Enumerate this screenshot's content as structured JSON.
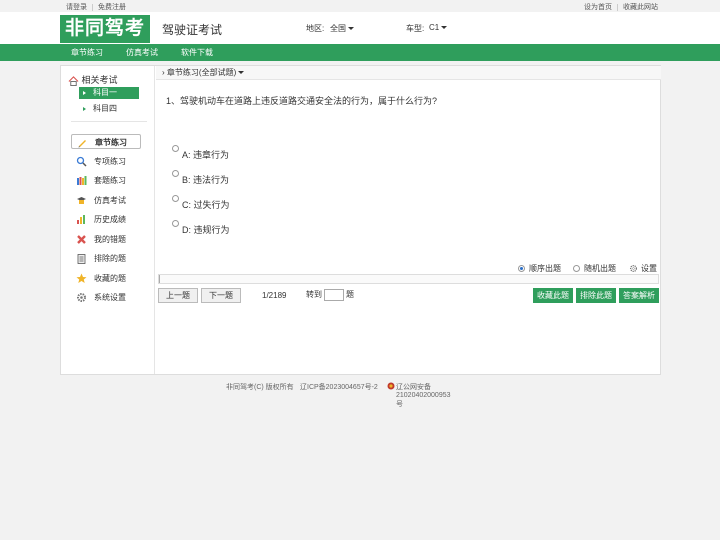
{
  "topbar": {
    "login": "请登录",
    "register": "免费注册",
    "set_home": "设为首页",
    "bookmark": "收藏此网站"
  },
  "header": {
    "logo": "非同驾考",
    "title": "驾驶证考试",
    "region_label": "地区:",
    "region_value": "全国",
    "car_label": "车型:",
    "car_value": "C1"
  },
  "nav": [
    "章节练习",
    "仿真考试",
    "软件下载"
  ],
  "sidebar": {
    "related_title": "相关考试",
    "subjects": [
      "科目一",
      "科目四"
    ],
    "menu": [
      "章节练习",
      "专项练习",
      "套题练习",
      "仿真考试",
      "历史成绩",
      "我的错题",
      "排除的题",
      "收藏的题",
      "系统设置"
    ]
  },
  "content": {
    "breadcrumb": "章节练习(全部试题)",
    "question": "1、驾驶机动车在道路上违反道路交通安全法的行为，属于什么行为?",
    "options": [
      "A: 违章行为",
      "B: 违法行为",
      "C: 过失行为",
      "D: 违规行为"
    ],
    "modes": {
      "sequential": "顺序出题",
      "random": "随机出题",
      "settings": "设置"
    },
    "prev": "上一题",
    "next": "下一题",
    "counter": "1/2189",
    "goto_prefix": "转到",
    "goto_suffix": "题",
    "goto_value": "",
    "fav": "收藏此题",
    "exclude": "排除此题",
    "answer": "答案解析",
    "progress_fraction": 0.0005
  },
  "footer": {
    "copyright": "非同驾考(C) 版权所有",
    "icp": "辽ICP备2023004657号-2",
    "police": "辽公网安备21020402000953号"
  },
  "colors": {
    "brand": "#2f9e5c",
    "radio_on": "#2a6fc9"
  }
}
